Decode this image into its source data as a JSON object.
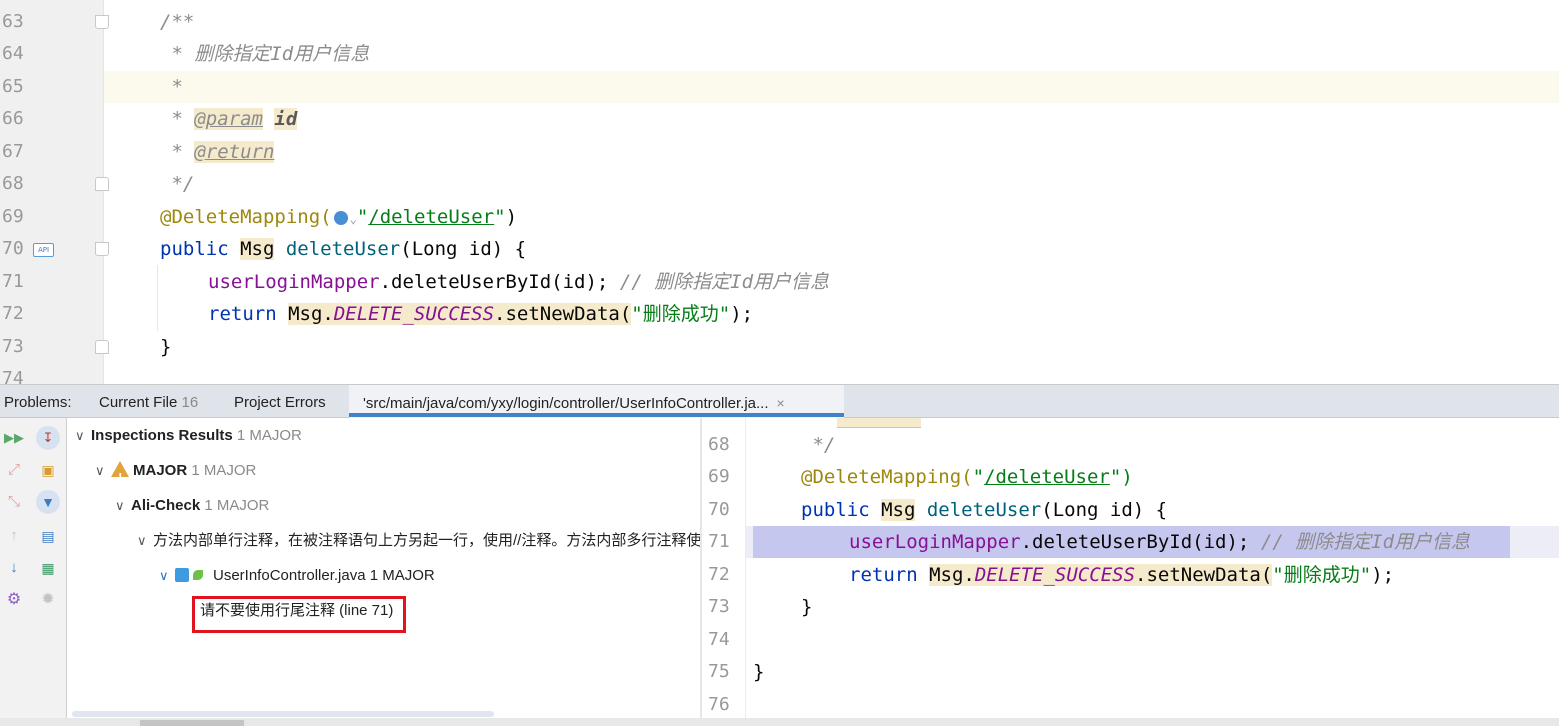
{
  "editor": {
    "line_numbers": [
      "63",
      "64",
      "65",
      "66",
      "67",
      "68",
      "69",
      "70",
      "71",
      "72",
      "73",
      "74"
    ],
    "l63": "/**",
    "l64_star": " * ",
    "l64_text": "删除指定Id用户信息",
    "l65": " *",
    "l66_star": " * ",
    "l66_tag": "@param",
    "l66_arg": "id",
    "l67_star": " * ",
    "l67_tag": "@return",
    "l68": " */",
    "l69_ann": "@DeleteMapping(",
    "l69_str_q": "\"",
    "l69_url": "/deleteUser",
    "l69_end_q": "\"",
    "l69_close": ")",
    "l70_kw": "public ",
    "l70_type": "Msg",
    "l70_fn": " deleteUser",
    "l70_rest": "(Long id) {",
    "l71_field": "userLoginMapper",
    "l71_call": ".deleteUserById(id); ",
    "l71_comment": "// 删除指定Id用户信息",
    "l72_kw": "return ",
    "l72_type": "Msg",
    "l72_dot": ".",
    "l72_const": "DELETE_SUCCESS",
    "l72_call": ".setNewData(",
    "l72_str": "\"删除成功\"",
    "l72_end": ");",
    "l73": "}",
    "api_badge": "API"
  },
  "problems_bar": {
    "label": "Problems:",
    "tabs": [
      {
        "label": "Current File",
        "count": "16"
      },
      {
        "label": "Project Errors",
        "count": ""
      },
      {
        "label": "'src/main/java/com/yxy/login/controller/UserInfoController.ja...",
        "count": ""
      }
    ],
    "close_glyph": "×"
  },
  "tree": {
    "root_label": "Inspections Results",
    "root_count": "1 MAJOR",
    "major_label": "MAJOR",
    "major_count": "1 MAJOR",
    "alicheck_label": "Ali-Check",
    "alicheck_count": "1 MAJOR",
    "rule_label": "方法内部单行注释，在被注释语句上方另起一行，使用//注释。方法内部多行注释使",
    "file_label": "UserInfoController.java",
    "file_count": "1 MAJOR",
    "problem_label": "请不要使用行尾注释 (line 71)"
  },
  "preview": {
    "line_numbers": [
      "68",
      "69",
      "70",
      "71",
      "72",
      "73",
      "74",
      "75",
      "76"
    ],
    "l68": " */",
    "l69_ann": "@DeleteMapping(",
    "l69_q": "\"",
    "l69_url": "/deleteUser",
    "l69_end": "\")",
    "l70_kw": "public ",
    "l70_type": "Msg",
    "l70_fn": " deleteUser",
    "l70_rest": "(Long id) {",
    "l71_field": "userLoginMapper",
    "l71_call": ".deleteUserById(id); ",
    "l71_comment": "// 删除指定Id用户信息",
    "l72_kw": "return ",
    "l72_type": "Msg",
    "l72_dot": ".",
    "l72_const": "DELETE_SUCCESS",
    "l72_call": ".setNewData(",
    "l72_str": "\"删除成功\"",
    "l72_end": ");",
    "l73": "}",
    "l75": "}"
  },
  "colors": {
    "keyword": "#0033b3",
    "annotation": "#9e880d",
    "string": "#067d17",
    "field": "#871094",
    "selection": "#bacde5",
    "error_box": "#e0141e"
  }
}
